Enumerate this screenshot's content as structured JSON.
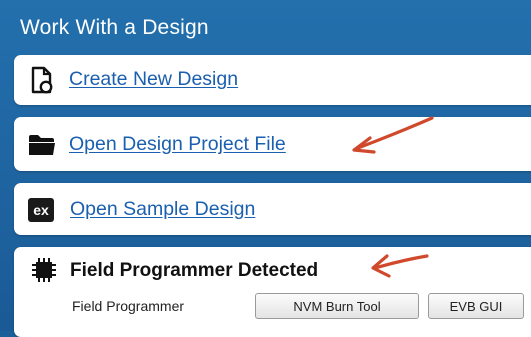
{
  "section": {
    "title": "Work With a Design"
  },
  "cards": {
    "create": {
      "label": "Create New Design",
      "icon": "new-document-icon"
    },
    "open_project": {
      "label": "Open Design Project File",
      "icon": "folder-icon"
    },
    "sample": {
      "label": "Open Sample Design",
      "icon": "ex-icon",
      "icon_text": "ex"
    },
    "programmer": {
      "heading": "Field Programmer Detected",
      "icon": "chip-icon",
      "sublabel": "Field Programmer",
      "buttons": [
        "NVM Burn Tool",
        "EVB GUI"
      ]
    }
  },
  "annotations": {
    "arrow_color": "#d1492c"
  },
  "colors": {
    "panel": "#1d5f99",
    "link": "#1b5fb0"
  }
}
